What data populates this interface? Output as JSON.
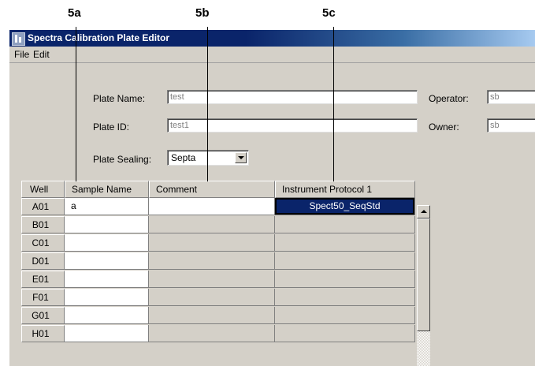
{
  "callouts": [
    {
      "label": "5a"
    },
    {
      "label": "5b"
    },
    {
      "label": "5c"
    }
  ],
  "window": {
    "title": "Spectral Calibration Plate Editor",
    "title_visible": "Spectra Calibration Plate Editor"
  },
  "menu": [
    "File",
    "Edit"
  ],
  "form": {
    "plate_name_label": "Plate Name:",
    "plate_name_value": "test",
    "plate_id_label": "Plate ID:",
    "plate_id_value": "test1",
    "plate_sealing_label": "Plate Sealing:",
    "plate_sealing_value": "Septa",
    "operator_label": "Operator:",
    "operator_value": "sb",
    "owner_label": "Owner:",
    "owner_value": "sb"
  },
  "table": {
    "columns": [
      "Well",
      "Sample Name",
      "Comment",
      "Instrument Protocol 1"
    ],
    "rows": [
      {
        "well": "A01",
        "sample_name": "a",
        "comment": "",
        "protocol": "Spect50_SeqStd"
      },
      {
        "well": "B01",
        "sample_name": "",
        "comment": "",
        "protocol": ""
      },
      {
        "well": "C01",
        "sample_name": "",
        "comment": "",
        "protocol": ""
      },
      {
        "well": "D01",
        "sample_name": "",
        "comment": "",
        "protocol": ""
      },
      {
        "well": "E01",
        "sample_name": "",
        "comment": "",
        "protocol": ""
      },
      {
        "well": "F01",
        "sample_name": "",
        "comment": "",
        "protocol": ""
      },
      {
        "well": "G01",
        "sample_name": "",
        "comment": "",
        "protocol": ""
      },
      {
        "well": "H01",
        "sample_name": "",
        "comment": "",
        "protocol": ""
      }
    ],
    "selected_cell": {
      "row": "A01",
      "column": "Instrument Protocol 1"
    }
  },
  "colors": {
    "titlebar": "#0a246a",
    "window_bg": "#d4d0c8",
    "selection": "#0a246a"
  }
}
